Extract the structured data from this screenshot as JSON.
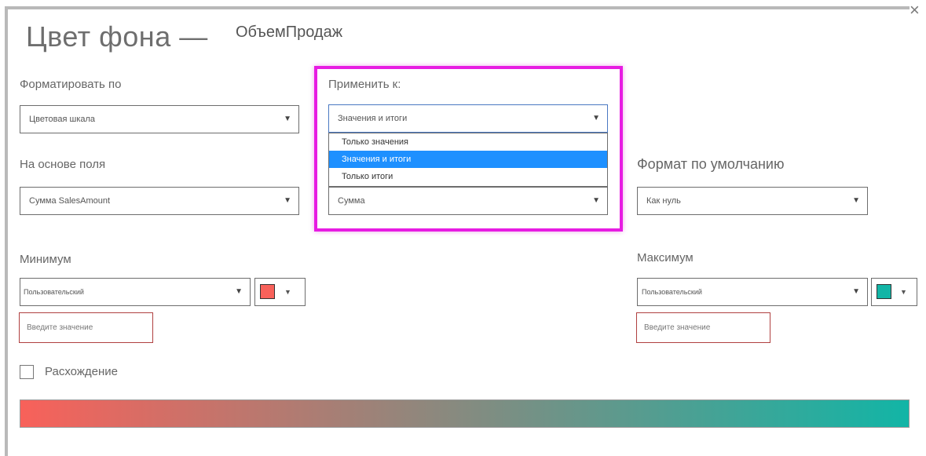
{
  "dialog": {
    "title": "Цвет фона —",
    "subtitle": "ОбъемПродаж",
    "close_glyph": "×"
  },
  "format_by": {
    "label": "Форматировать по",
    "value": "Цветовая шкала"
  },
  "based_on_field": {
    "label": "На основе поля",
    "value": "Сумма SalesAmount"
  },
  "apply_to": {
    "label": "Применить к:",
    "value": "Значения и итоги",
    "options": [
      "Только значения",
      "Значения и итоги",
      "Только итоги"
    ],
    "selected_index": 1
  },
  "summarization": {
    "value": "Сумма"
  },
  "default_format": {
    "label": "Формат по умолчанию",
    "value": "Как нуль"
  },
  "minimum": {
    "label": "Минимум",
    "value": "Пользовательский",
    "color": "#f8615a",
    "placeholder": "Введите значение"
  },
  "maximum": {
    "label": "Максимум",
    "value": "Пользовательский",
    "color": "#12b5a6",
    "placeholder": "Введите значение"
  },
  "diverging": {
    "label": "Расхождение",
    "checked": false
  },
  "gradient": {
    "start_color": "#f8615a",
    "end_color": "#12b5a6"
  },
  "colors": {
    "highlight": "#e71ce2",
    "selected_option": "#1e90ff",
    "input_border": "#b04040"
  },
  "icons": {
    "dropdown_arrow": "▼",
    "swatch_arrow": "▼"
  }
}
